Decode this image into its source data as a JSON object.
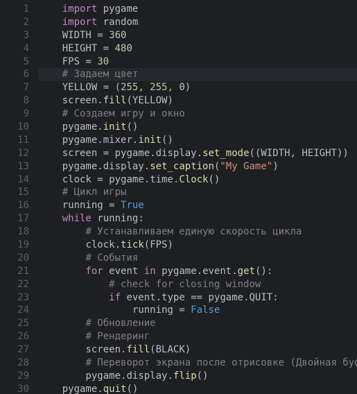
{
  "editor": {
    "highlighted_line": 6,
    "lines": [
      {
        "n": 1,
        "indent": 1,
        "tokens": [
          [
            "kw",
            "import"
          ],
          [
            "pn",
            " "
          ],
          [
            "id",
            "pygame"
          ]
        ]
      },
      {
        "n": 2,
        "indent": 1,
        "tokens": [
          [
            "kw",
            "import"
          ],
          [
            "pn",
            " "
          ],
          [
            "id",
            "random"
          ]
        ]
      },
      {
        "n": 3,
        "indent": 1,
        "tokens": [
          [
            "id",
            "WIDTH"
          ],
          [
            "pn",
            " = "
          ],
          [
            "num",
            "360"
          ]
        ]
      },
      {
        "n": 4,
        "indent": 1,
        "tokens": [
          [
            "id",
            "HEIGHT"
          ],
          [
            "pn",
            " = "
          ],
          [
            "num",
            "480"
          ]
        ]
      },
      {
        "n": 5,
        "indent": 1,
        "tokens": [
          [
            "id",
            "FPS"
          ],
          [
            "pn",
            " = "
          ],
          [
            "num",
            "30"
          ]
        ]
      },
      {
        "n": 6,
        "indent": 1,
        "tokens": [
          [
            "cmt",
            "# Задаем цвет"
          ]
        ]
      },
      {
        "n": 7,
        "indent": 1,
        "tokens": [
          [
            "id",
            "YELLOW"
          ],
          [
            "pn",
            " = ("
          ],
          [
            "num",
            "255"
          ],
          [
            "pn",
            ", "
          ],
          [
            "num",
            "255"
          ],
          [
            "pn",
            ", "
          ],
          [
            "num",
            "0"
          ],
          [
            "pn",
            ")"
          ]
        ]
      },
      {
        "n": 8,
        "indent": 1,
        "tokens": [
          [
            "id",
            "screen"
          ],
          [
            "pn",
            "."
          ],
          [
            "fn",
            "fill"
          ],
          [
            "pn",
            "("
          ],
          [
            "id",
            "YELLOW"
          ],
          [
            "pn",
            ")"
          ]
        ]
      },
      {
        "n": 9,
        "indent": 1,
        "tokens": [
          [
            "cmt",
            "# Создаем игру и окно"
          ]
        ]
      },
      {
        "n": 10,
        "indent": 1,
        "tokens": [
          [
            "id",
            "pygame"
          ],
          [
            "pn",
            "."
          ],
          [
            "fn",
            "init"
          ],
          [
            "pn",
            "()"
          ]
        ]
      },
      {
        "n": 11,
        "indent": 1,
        "tokens": [
          [
            "id",
            "pygame"
          ],
          [
            "pn",
            "."
          ],
          [
            "id",
            "mixer"
          ],
          [
            "pn",
            "."
          ],
          [
            "fn",
            "init"
          ],
          [
            "pn",
            "()"
          ]
        ]
      },
      {
        "n": 12,
        "indent": 1,
        "tokens": [
          [
            "id",
            "screen"
          ],
          [
            "pn",
            " = "
          ],
          [
            "id",
            "pygame"
          ],
          [
            "pn",
            "."
          ],
          [
            "id",
            "display"
          ],
          [
            "pn",
            "."
          ],
          [
            "fn",
            "set_mode"
          ],
          [
            "pn",
            "(("
          ],
          [
            "id",
            "WIDTH"
          ],
          [
            "pn",
            ", "
          ],
          [
            "id",
            "HEIGHT"
          ],
          [
            "pn",
            "))"
          ]
        ]
      },
      {
        "n": 13,
        "indent": 1,
        "tokens": [
          [
            "id",
            "pygame"
          ],
          [
            "pn",
            "."
          ],
          [
            "id",
            "display"
          ],
          [
            "pn",
            "."
          ],
          [
            "fn",
            "set_caption"
          ],
          [
            "pn",
            "("
          ],
          [
            "str",
            "\"My Game\""
          ],
          [
            "pn",
            ")"
          ]
        ]
      },
      {
        "n": 14,
        "indent": 1,
        "tokens": [
          [
            "id",
            "clock"
          ],
          [
            "pn",
            " = "
          ],
          [
            "id",
            "pygame"
          ],
          [
            "pn",
            "."
          ],
          [
            "id",
            "time"
          ],
          [
            "pn",
            "."
          ],
          [
            "fn",
            "Clock"
          ],
          [
            "pn",
            "()"
          ]
        ]
      },
      {
        "n": 15,
        "indent": 1,
        "tokens": [
          [
            "cmt",
            "# Цикл игры"
          ]
        ]
      },
      {
        "n": 16,
        "indent": 1,
        "tokens": [
          [
            "id",
            "running"
          ],
          [
            "pn",
            " = "
          ],
          [
            "bool",
            "True"
          ]
        ]
      },
      {
        "n": 17,
        "indent": 1,
        "tokens": [
          [
            "kw",
            "while"
          ],
          [
            "pn",
            " "
          ],
          [
            "id",
            "running"
          ],
          [
            "pn",
            ":"
          ]
        ]
      },
      {
        "n": 18,
        "indent": 2,
        "tokens": [
          [
            "cmt",
            "# Устанавливаем единую скорость цикла"
          ]
        ]
      },
      {
        "n": 19,
        "indent": 2,
        "tokens": [
          [
            "id",
            "clock"
          ],
          [
            "pn",
            "."
          ],
          [
            "fn",
            "tick"
          ],
          [
            "pn",
            "("
          ],
          [
            "id",
            "FPS"
          ],
          [
            "pn",
            ")"
          ]
        ]
      },
      {
        "n": 20,
        "indent": 2,
        "tokens": [
          [
            "cmt",
            "# События"
          ]
        ]
      },
      {
        "n": 21,
        "indent": 2,
        "tokens": [
          [
            "kw",
            "for"
          ],
          [
            "pn",
            " "
          ],
          [
            "id",
            "event"
          ],
          [
            "pn",
            " "
          ],
          [
            "kw",
            "in"
          ],
          [
            "pn",
            " "
          ],
          [
            "id",
            "pygame"
          ],
          [
            "pn",
            "."
          ],
          [
            "id",
            "event"
          ],
          [
            "pn",
            "."
          ],
          [
            "fn",
            "get"
          ],
          [
            "pn",
            "():"
          ]
        ]
      },
      {
        "n": 22,
        "indent": 3,
        "tokens": [
          [
            "cmt",
            "# check for closing window"
          ]
        ]
      },
      {
        "n": 23,
        "indent": 3,
        "tokens": [
          [
            "kw",
            "if"
          ],
          [
            "pn",
            " "
          ],
          [
            "id",
            "event"
          ],
          [
            "pn",
            "."
          ],
          [
            "id",
            "type"
          ],
          [
            "pn",
            " == "
          ],
          [
            "id",
            "pygame"
          ],
          [
            "pn",
            "."
          ],
          [
            "id",
            "QUIT"
          ],
          [
            "pn",
            ":"
          ]
        ]
      },
      {
        "n": 24,
        "indent": 4,
        "tokens": [
          [
            "id",
            "running"
          ],
          [
            "pn",
            " = "
          ],
          [
            "bool",
            "False"
          ]
        ]
      },
      {
        "n": 25,
        "indent": 2,
        "tokens": [
          [
            "cmt",
            "# Обновление"
          ]
        ]
      },
      {
        "n": 26,
        "indent": 2,
        "tokens": [
          [
            "cmt",
            "# Рендеринг"
          ]
        ]
      },
      {
        "n": 27,
        "indent": 2,
        "tokens": [
          [
            "id",
            "screen"
          ],
          [
            "pn",
            "."
          ],
          [
            "fn",
            "fill"
          ],
          [
            "pn",
            "("
          ],
          [
            "id",
            "BLACK"
          ],
          [
            "pn",
            ")"
          ]
        ]
      },
      {
        "n": 28,
        "indent": 2,
        "tokens": [
          [
            "cmt",
            "# Переворот экрана после отрисовке (Двойная буферизация)"
          ]
        ]
      },
      {
        "n": 29,
        "indent": 2,
        "tokens": [
          [
            "id",
            "pygame"
          ],
          [
            "pn",
            "."
          ],
          [
            "id",
            "display"
          ],
          [
            "pn",
            "."
          ],
          [
            "fn",
            "flip"
          ],
          [
            "pn",
            "()"
          ]
        ]
      },
      {
        "n": 30,
        "indent": 1,
        "tokens": [
          [
            "id",
            "pygame"
          ],
          [
            "pn",
            "."
          ],
          [
            "fn",
            "quit"
          ],
          [
            "pn",
            "()"
          ]
        ]
      }
    ]
  }
}
